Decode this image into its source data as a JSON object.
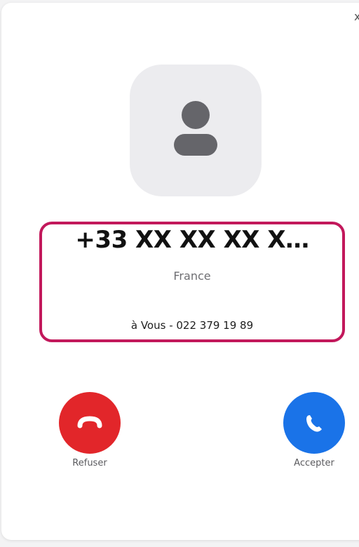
{
  "call": {
    "number": "+33 XX XX  XX X…",
    "country": "France",
    "target": "à Vous - 022 379 19 89"
  },
  "actions": {
    "decline_label": "Refuser",
    "accept_label": "Accepter"
  },
  "window": {
    "close_glyph": "x"
  },
  "icons": {
    "avatar": "person-icon",
    "decline": "phone-hangup-icon",
    "accept": "phone-icon",
    "close": "close-icon"
  },
  "colors": {
    "decline": "#e2262a",
    "accept": "#1a73e8",
    "highlight": "#c2185b",
    "avatar_bg": "#ececef"
  }
}
